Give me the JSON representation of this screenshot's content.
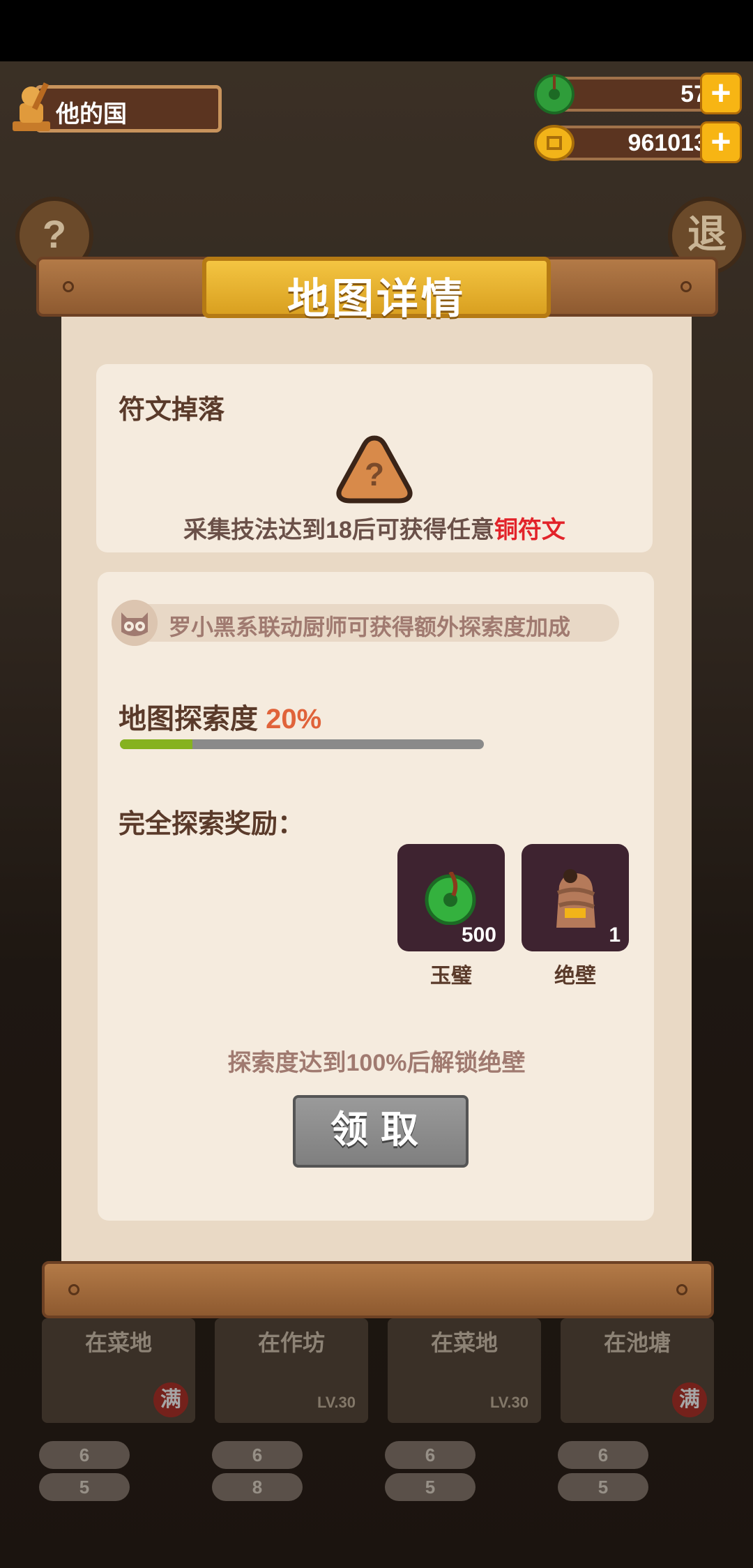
{
  "top": {
    "kingdom_name": "他的国",
    "jade_count": "57",
    "coin_count": "961013"
  },
  "side_buttons": {
    "left": "?",
    "right": "退"
  },
  "panel": {
    "title": "地图详情",
    "rune": {
      "heading": "符文掉落",
      "unknown_mark": "?",
      "requirement": "采集技法达到18后可获得任意",
      "rune_type": "铜符文"
    },
    "hint": "罗小黑系联动厨师可获得额外探索度加成",
    "exploration": {
      "label": "地图探索度",
      "percent_text": "20%",
      "percent": 20
    },
    "full_reward_label": "完全探索奖励：",
    "rewards": [
      {
        "name": "玉璧",
        "count": "500",
        "icon": "jade-disc-icon"
      },
      {
        "name": "绝壁",
        "count": "1",
        "icon": "cliff-icon"
      }
    ],
    "unlock_note": "探索度达到100%后解锁绝壁",
    "claim_button": "领取"
  },
  "background_cards": [
    {
      "location": "在菜地",
      "badge": "满",
      "lv": ""
    },
    {
      "location": "在作坊",
      "badge": "",
      "lv": "LV.30"
    },
    {
      "location": "在菜地",
      "badge": "",
      "lv": "LV.30"
    },
    {
      "location": "在池塘",
      "badge": "满",
      "lv": ""
    }
  ],
  "background_stats": [
    [
      "6",
      "5"
    ],
    [
      "6",
      "8"
    ],
    [
      "6",
      "5"
    ],
    [
      "6",
      "5"
    ]
  ],
  "colors": {
    "accent_gold": "#f4c542",
    "rune_red": "#e2232a",
    "progress_green": "#86b21f",
    "percent_orange": "#e0633a"
  }
}
